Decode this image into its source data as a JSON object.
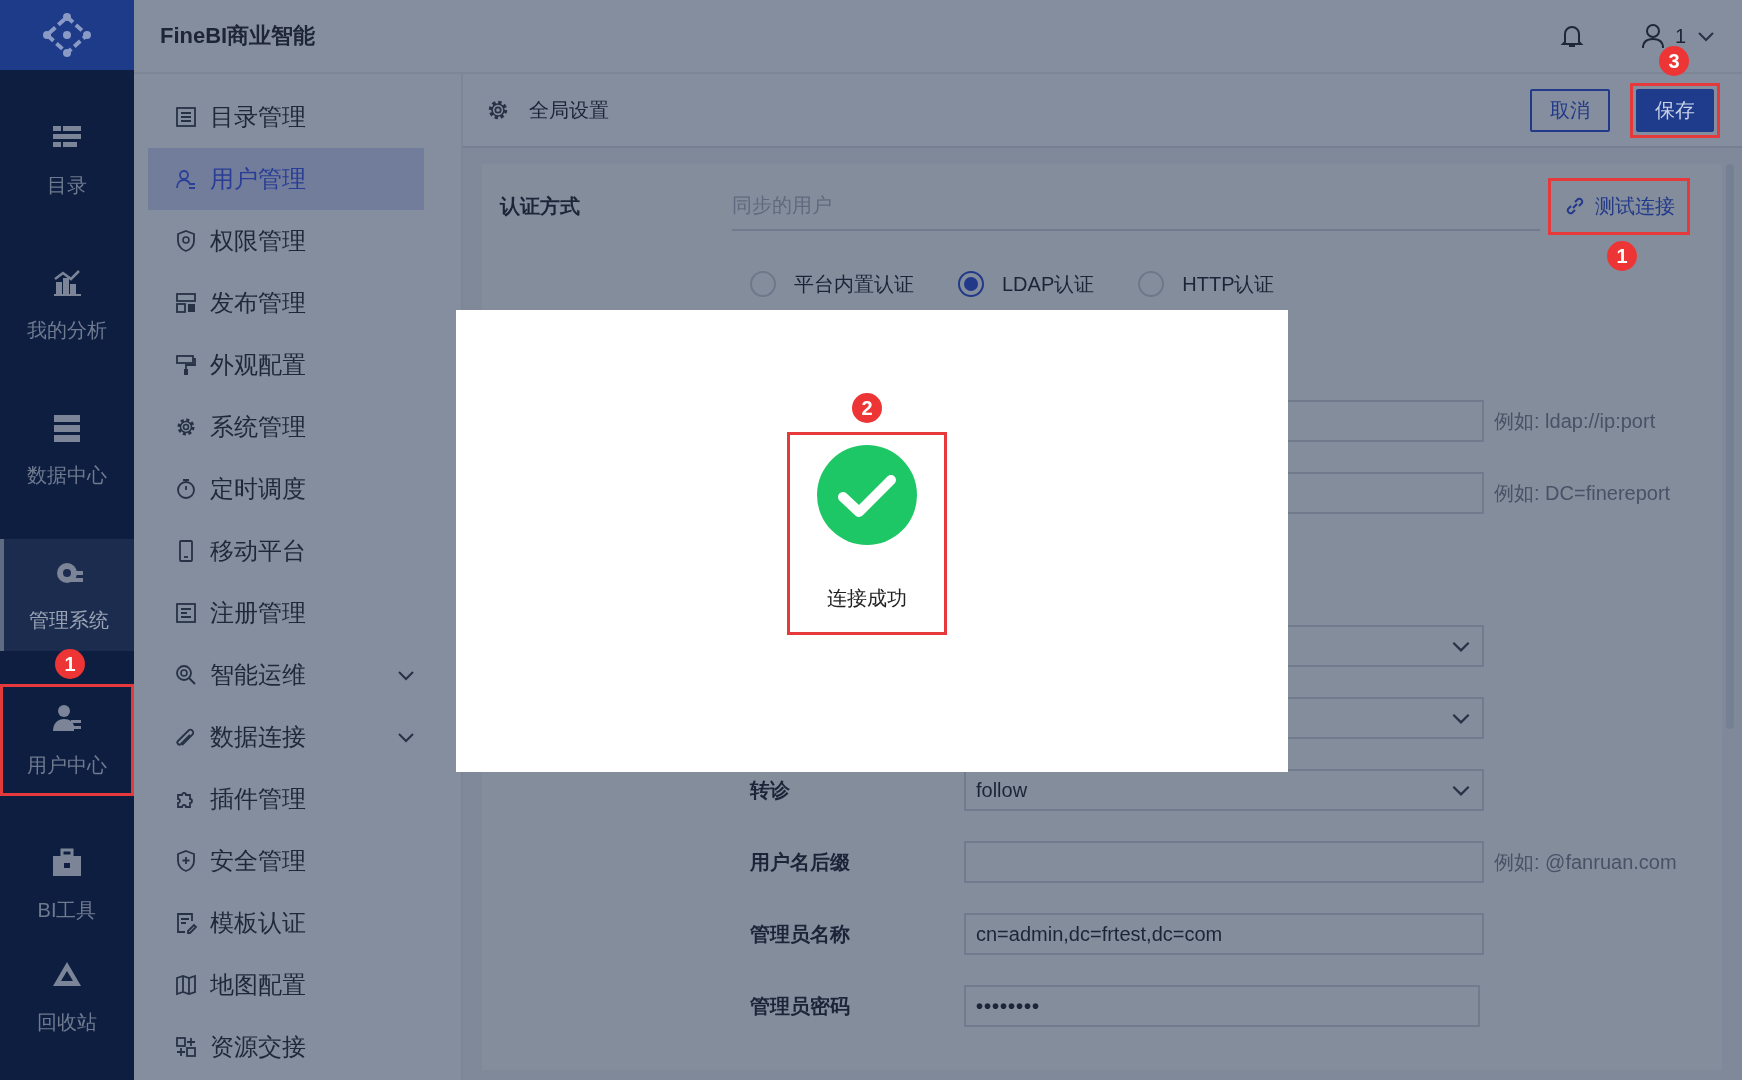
{
  "app": {
    "title": "FineBI商业智能",
    "user": "1"
  },
  "nav": [
    {
      "label": "目录",
      "selected": false
    },
    {
      "label": "我的分析",
      "selected": false
    },
    {
      "label": "数据中心",
      "selected": false
    },
    {
      "label": "管理系统",
      "selected": true
    },
    {
      "label": "用户中心",
      "selected": false,
      "callout": "1"
    },
    {
      "label": "BI工具",
      "selected": false
    },
    {
      "label": "回收站",
      "selected": false
    }
  ],
  "menu": [
    {
      "label": "目录管理",
      "selected": false,
      "has_submenu": false
    },
    {
      "label": "用户管理",
      "selected": true,
      "has_submenu": false
    },
    {
      "label": "权限管理",
      "selected": false,
      "has_submenu": false
    },
    {
      "label": "发布管理",
      "selected": false,
      "has_submenu": false
    },
    {
      "label": "外观配置",
      "selected": false,
      "has_submenu": false
    },
    {
      "label": "系统管理",
      "selected": false,
      "has_submenu": false
    },
    {
      "label": "定时调度",
      "selected": false,
      "has_submenu": false
    },
    {
      "label": "移动平台",
      "selected": false,
      "has_submenu": false
    },
    {
      "label": "注册管理",
      "selected": false,
      "has_submenu": false
    },
    {
      "label": "智能运维",
      "selected": false,
      "has_submenu": true
    },
    {
      "label": "数据连接",
      "selected": false,
      "has_submenu": true
    },
    {
      "label": "插件管理",
      "selected": false,
      "has_submenu": false
    },
    {
      "label": "安全管理",
      "selected": false,
      "has_submenu": false
    },
    {
      "label": "模板认证",
      "selected": false,
      "has_submenu": false
    },
    {
      "label": "地图配置",
      "selected": false,
      "has_submenu": false
    },
    {
      "label": "资源交接",
      "selected": false,
      "has_submenu": false
    }
  ],
  "page": {
    "title": "全局设置",
    "buttons": [
      {
        "label": "取消",
        "kind": "secondary"
      },
      {
        "label": "保存",
        "kind": "primary",
        "callout": "3"
      }
    ]
  },
  "form": {
    "auth": {
      "label": "认证方式",
      "placeholder": "同步的用户"
    },
    "test_button": {
      "label": "测试连接",
      "callout": "1"
    },
    "radios": [
      {
        "label": "平台内置认证",
        "selected": false
      },
      {
        "label": "LDAP认证",
        "selected": true
      },
      {
        "label": "HTTP认证",
        "selected": false
      }
    ],
    "rows": [
      {
        "kind": "input",
        "hint": "例如: ldap://ip:port"
      },
      {
        "kind": "input",
        "hint": "例如: DC=finereport"
      },
      {
        "kind": "select"
      },
      {
        "kind": "select"
      },
      {
        "kind": "select",
        "label": "转诊",
        "value": "follow"
      },
      {
        "kind": "input",
        "label": "用户名后缀",
        "hint": "例如: @fanruan.com"
      },
      {
        "kind": "input",
        "label": "管理员名称",
        "value": "cn=admin,dc=frtest,dc=com"
      },
      {
        "kind": "password",
        "label": "管理员密码",
        "value": "••••••••"
      }
    ]
  },
  "dialog": {
    "message": "连接成功",
    "callout": "2"
  }
}
